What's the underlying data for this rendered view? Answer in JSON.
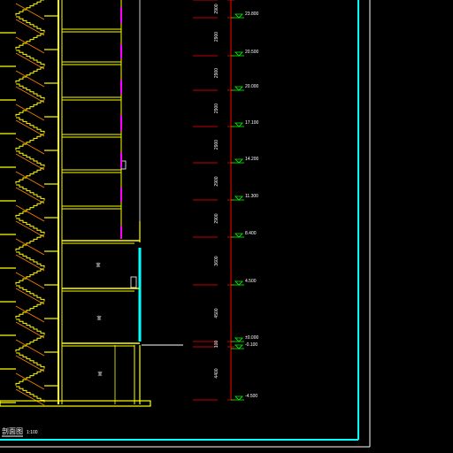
{
  "drawing": {
    "caption": "剖面图",
    "scale": "1:100",
    "colors": {
      "background": "#000000",
      "structure": "#ffff00",
      "stair": "#ff8000",
      "accent": "#ff00ff",
      "border": "#00ffff",
      "dimension": "#ff0000",
      "elevation_mark": "#00ff00",
      "text": "#ffffff"
    },
    "elevations": [
      "23.800",
      "20.500",
      "20.000",
      "17.100",
      "14.200",
      "11.300",
      "8.400",
      "4.500",
      "±0.000",
      "-0.100",
      "-4.500"
    ],
    "dimensions": [
      "2900",
      "2900",
      "2900",
      "2900",
      "2900",
      "2900",
      "2900",
      "3600",
      "4500",
      "100",
      "4400"
    ],
    "rooms": [
      "室",
      "室",
      "室"
    ]
  }
}
